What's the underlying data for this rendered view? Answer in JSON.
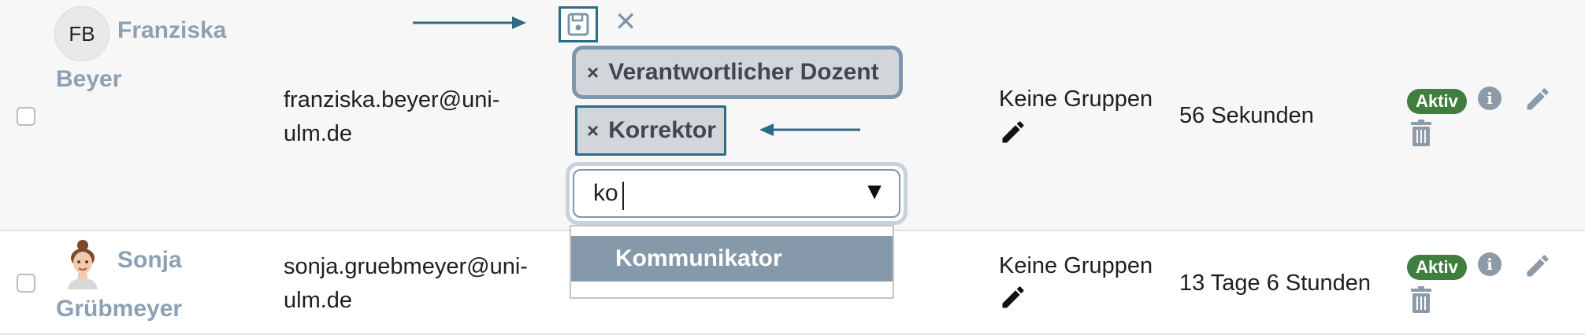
{
  "rows": [
    {
      "initials": "FB",
      "first_name": "Franziska",
      "last_name": "Beyer",
      "email_line1": "franziska.beyer@uni-",
      "email_line2": "ulm.de",
      "tags": [
        "Verantwortlicher Dozent",
        "Korrektor"
      ],
      "tag_remove_symbol": "×",
      "input_value": "ko",
      "dropdown_arrow": "▼",
      "dropdown_option": "Kommunikator",
      "groups": "Keine Gruppen",
      "last_active": "56 Sekunden",
      "status": "Aktiv"
    },
    {
      "first_name": "Sonja",
      "last_name": "Grübmeyer",
      "email_line1": "sonja.gruebmeyer@uni-",
      "email_line2": "ulm.de",
      "groups": "Keine Gruppen",
      "last_active": "13 Tage 6 Stunden",
      "status": "Aktiv"
    }
  ],
  "icons": {
    "save": "save-icon",
    "cancel": "close-icon",
    "cancel_glyph": "✕",
    "edit": "pencil-icon",
    "info": "info-icon",
    "info_glyph": "i",
    "delete": "trash-icon",
    "annotation": "arrow-icon"
  },
  "colors": {
    "name": "#8ea0b3",
    "status_badge": "#3f7e3e",
    "highlight": "#2e6b86",
    "option_bg": "#8599ab"
  }
}
